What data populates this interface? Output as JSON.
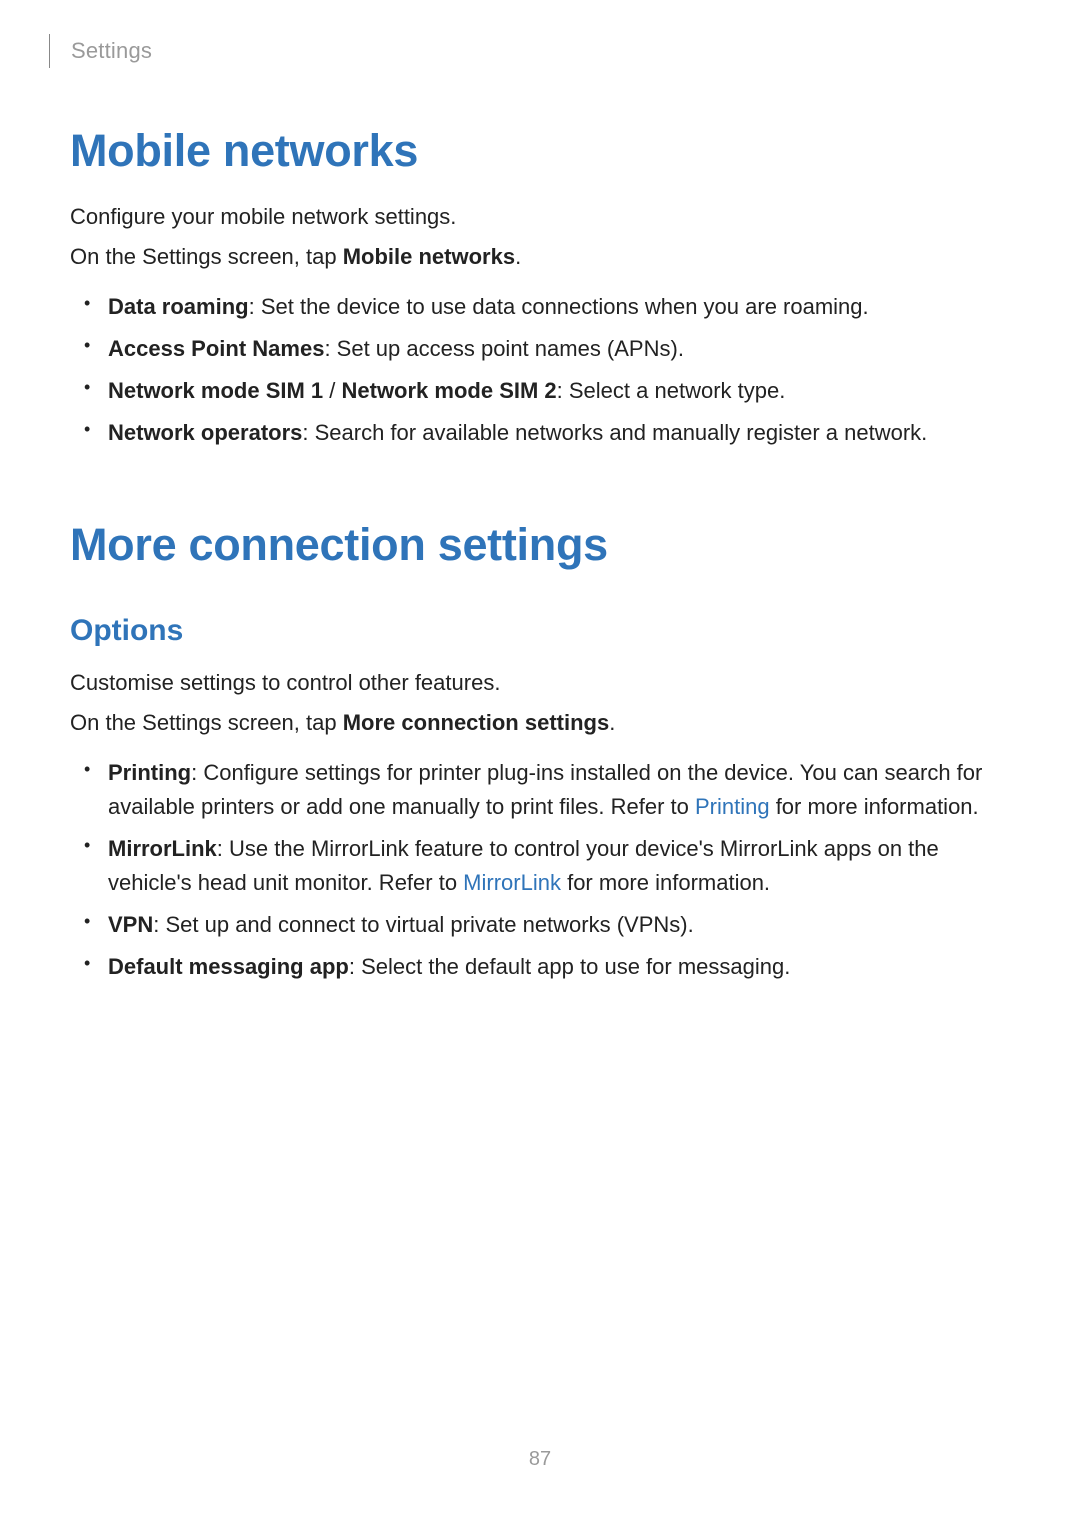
{
  "header": {
    "running_title": "Settings"
  },
  "section1": {
    "title": "Mobile networks",
    "intro1": "Configure your mobile network settings.",
    "intro2_pre": "On the Settings screen, tap ",
    "intro2_bold": "Mobile networks",
    "intro2_post": ".",
    "bullets": [
      {
        "term": "Data roaming",
        "desc": ": Set the device to use data connections when you are roaming."
      },
      {
        "term": "Access Point Names",
        "desc": ": Set up access point names (APNs)."
      },
      {
        "term_a": "Network mode SIM 1",
        "sep": " / ",
        "term_b": "Network mode SIM 2",
        "desc": ": Select a network type."
      },
      {
        "term": "Network operators",
        "desc": ": Search for available networks and manually register a network."
      }
    ]
  },
  "section2": {
    "title": "More connection settings",
    "sub_title": "Options",
    "intro1": "Customise settings to control other features.",
    "intro2_pre": "On the Settings screen, tap ",
    "intro2_bold": "More connection settings",
    "intro2_post": ".",
    "bullets": [
      {
        "term": "Printing",
        "desc_a": ": Configure settings for printer plug-ins installed on the device. You can search for available printers or add one manually to print files. Refer to ",
        "link": "Printing",
        "desc_b": " for more information."
      },
      {
        "term": "MirrorLink",
        "desc_a": ": Use the MirrorLink feature to control your device's MirrorLink apps on the vehicle's head unit monitor. Refer to ",
        "link": "MirrorLink",
        "desc_b": " for more information."
      },
      {
        "term": "VPN",
        "desc": ": Set up and connect to virtual private networks (VPNs)."
      },
      {
        "term": "Default messaging app",
        "desc": ": Select the default app to use for messaging."
      }
    ]
  },
  "page_number": "87"
}
